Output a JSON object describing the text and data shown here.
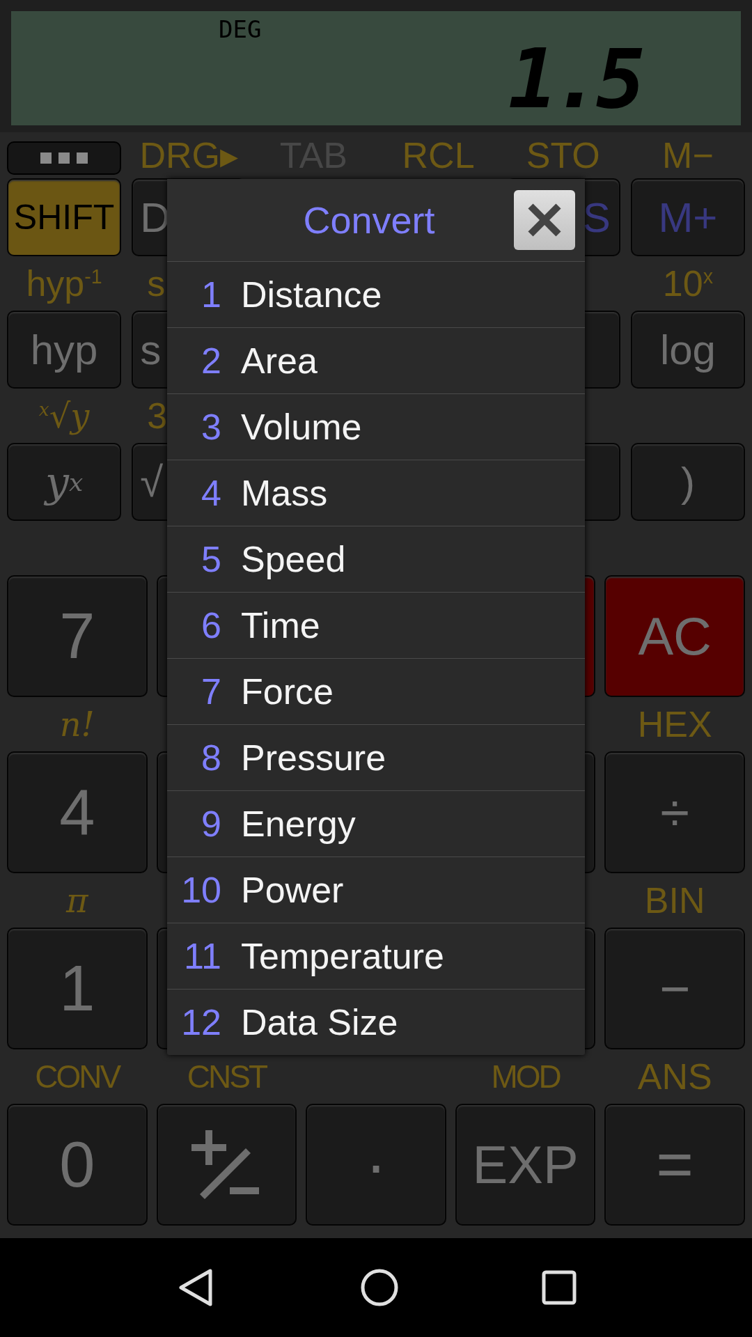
{
  "display": {
    "mode": "DEG",
    "value": "1.5"
  },
  "top_rows": [
    {
      "labels": [
        {
          "text": "DRG▸",
          "kind": "plain",
          "disabled": false
        },
        {
          "text": "TAB",
          "kind": "plain",
          "disabled": true
        },
        {
          "text": "RCL",
          "kind": "plain",
          "disabled": false
        },
        {
          "text": "STO",
          "kind": "plain",
          "disabled": false
        },
        {
          "text": "M−",
          "kind": "plain",
          "disabled": false
        }
      ],
      "keys": [
        {
          "text": "SHIFT",
          "kind": "shift"
        },
        {
          "text": "D",
          "kind": "plain"
        },
        {
          "text": "S",
          "kind": "memory"
        },
        {
          "text": "M+",
          "kind": "memory"
        }
      ]
    },
    {
      "labels": [
        {
          "text": "hyp$^{-1}$",
          "kind": "plain",
          "disabled": false
        },
        {
          "text": "s",
          "kind": "plain",
          "disabled": false
        },
        {
          "text": "10$^{x}$",
          "kind": "plain",
          "disabled": false
        }
      ],
      "keys": [
        {
          "text": "hyp",
          "kind": "plain"
        },
        {
          "text": "s",
          "kind": "plain"
        },
        {
          "kind": "plain"
        },
        {
          "text": "log",
          "kind": "plain"
        }
      ]
    },
    {
      "labels": [
        {
          "text": "$^{x}$√y",
          "kind": "math",
          "disabled": false
        },
        {
          "text": "3",
          "kind": "plain",
          "disabled": false
        }
      ],
      "keys": [
        {
          "text": "y$^{x}$",
          "kind": "math"
        },
        {
          "text": "√",
          "kind": "plain"
        },
        {
          "kind": "plain"
        },
        {
          "text": ")",
          "kind": "plain"
        }
      ]
    }
  ],
  "bottom_rows": [
    {
      "labels": [],
      "keys": [
        {
          "text": "7",
          "kind": "plain"
        },
        {
          "kind": "plain"
        },
        {
          "kind": "red"
        },
        {
          "text": "AC",
          "kind": "red"
        }
      ]
    },
    {
      "labels": [
        {
          "text": "n!",
          "kind": "math",
          "disabled": false
        },
        {
          "text": "HEX",
          "kind": "plain",
          "disabled": false
        }
      ],
      "keys": [
        {
          "text": "4",
          "kind": "plain"
        },
        {
          "kind": "plain"
        },
        {
          "kind": "plain"
        },
        {
          "text": "÷",
          "kind": "plain"
        }
      ]
    },
    {
      "labels": [
        {
          "text": "π",
          "kind": "math",
          "disabled": false
        },
        {
          "text": "BIN",
          "kind": "plain",
          "disabled": false
        }
      ],
      "keys": [
        {
          "text": "1",
          "kind": "plain"
        },
        {
          "kind": "plain"
        },
        {
          "kind": "plain"
        },
        {
          "text": "−",
          "kind": "plain"
        }
      ]
    },
    {
      "labels": [
        {
          "text": "CONV",
          "kind": "narrow",
          "disabled": false
        },
        {
          "text": "CNST",
          "kind": "narrow",
          "disabled": false
        },
        {
          "text": "MOD",
          "kind": "narrow",
          "disabled": false
        },
        {
          "text": "ANS",
          "kind": "plain",
          "disabled": false
        }
      ],
      "keys": [
        {
          "text": "0",
          "kind": "plain"
        },
        {
          "kind": "plusminus"
        },
        {
          "text": "·",
          "kind": "plain"
        },
        {
          "text": "EXP",
          "kind": "plain"
        },
        {
          "text": "=",
          "kind": "plain"
        }
      ]
    }
  ],
  "dialog": {
    "title": "Convert",
    "items": [
      {
        "number": "1",
        "label": "Distance"
      },
      {
        "number": "2",
        "label": "Area"
      },
      {
        "number": "3",
        "label": "Volume"
      },
      {
        "number": "4",
        "label": "Mass"
      },
      {
        "number": "5",
        "label": "Speed"
      },
      {
        "number": "6",
        "label": "Time"
      },
      {
        "number": "7",
        "label": "Force"
      },
      {
        "number": "8",
        "label": "Pressure"
      },
      {
        "number": "9",
        "label": "Energy"
      },
      {
        "number": "10",
        "label": "Power"
      },
      {
        "number": "11",
        "label": "Temperature"
      },
      {
        "number": "12",
        "label": "Data Size"
      }
    ]
  }
}
